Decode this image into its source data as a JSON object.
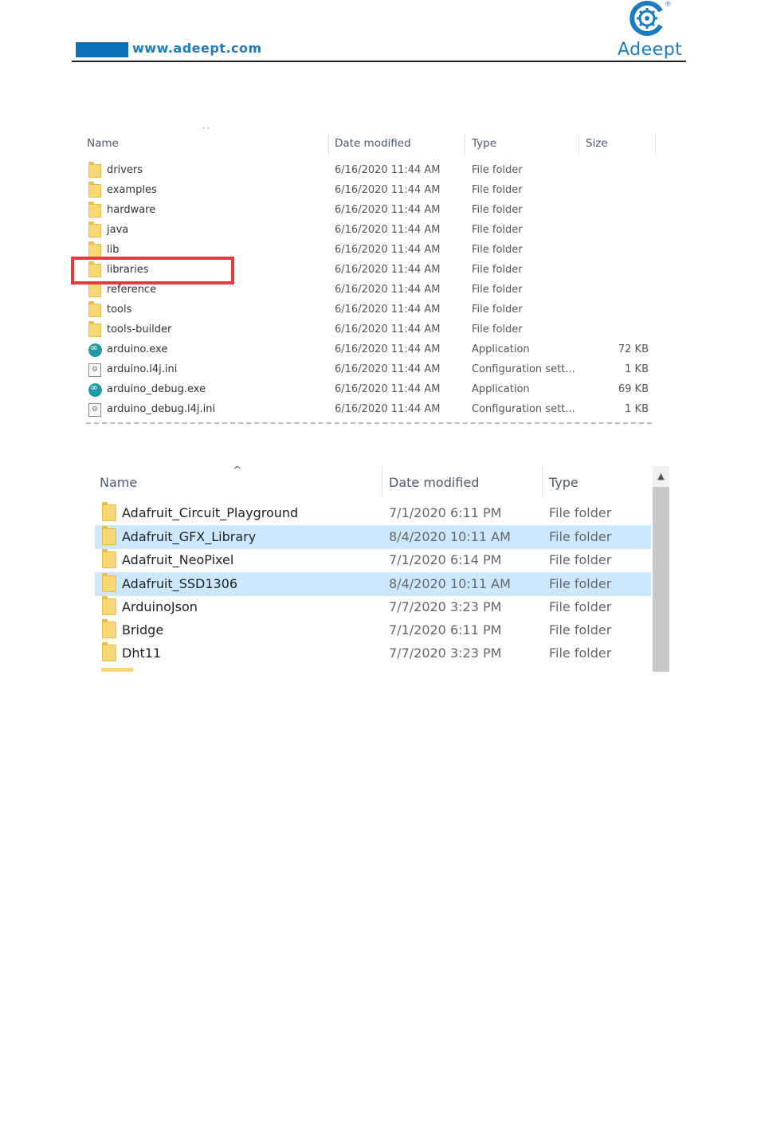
{
  "header": {
    "url": "www.adeept.com",
    "brand": "Adeept",
    "registered": "®"
  },
  "explorer1": {
    "columns": {
      "name": "Name",
      "date": "Date modified",
      "type": "Type",
      "size": "Size"
    },
    "sort_indicator": "˙˙",
    "rows": [
      {
        "icon": "folder-icon",
        "name": "drivers",
        "date": "6/16/2020 11:44 AM",
        "type": "File folder",
        "size": ""
      },
      {
        "icon": "folder-icon",
        "name": "examples",
        "date": "6/16/2020 11:44 AM",
        "type": "File folder",
        "size": ""
      },
      {
        "icon": "folder-icon",
        "name": "hardware",
        "date": "6/16/2020 11:44 AM",
        "type": "File folder",
        "size": ""
      },
      {
        "icon": "folder-icon",
        "name": "java",
        "date": "6/16/2020 11:44 AM",
        "type": "File folder",
        "size": ""
      },
      {
        "icon": "folder-icon",
        "name": "lib",
        "date": "6/16/2020 11:44 AM",
        "type": "File folder",
        "size": ""
      },
      {
        "icon": "folder-icon",
        "name": "libraries",
        "date": "6/16/2020 11:44 AM",
        "type": "File folder",
        "size": "",
        "highlighted": true
      },
      {
        "icon": "folder-icon",
        "name": "reference",
        "date": "6/16/2020 11:44 AM",
        "type": "File folder",
        "size": ""
      },
      {
        "icon": "folder-icon",
        "name": "tools",
        "date": "6/16/2020 11:44 AM",
        "type": "File folder",
        "size": ""
      },
      {
        "icon": "folder-icon",
        "name": "tools-builder",
        "date": "6/16/2020 11:44 AM",
        "type": "File folder",
        "size": ""
      },
      {
        "icon": "arduino-app-icon",
        "name": "arduino.exe",
        "date": "6/16/2020 11:44 AM",
        "type": "Application",
        "size": "72 KB"
      },
      {
        "icon": "config-file-icon",
        "name": "arduino.l4j.ini",
        "date": "6/16/2020 11:44 AM",
        "type": "Configuration sett...",
        "size": "1 KB"
      },
      {
        "icon": "arduino-app-icon",
        "name": "arduino_debug.exe",
        "date": "6/16/2020 11:44 AM",
        "type": "Application",
        "size": "69 KB"
      },
      {
        "icon": "config-file-icon",
        "name": "arduino_debug.l4j.ini",
        "date": "6/16/2020 11:44 AM",
        "type": "Configuration sett...",
        "size": "1 KB"
      }
    ]
  },
  "explorer2": {
    "columns": {
      "name": "Name",
      "date": "Date modified",
      "type": "Type"
    },
    "sort_indicator": "^",
    "scroll_up": "▲",
    "rows": [
      {
        "name": "Adafruit_Circuit_Playground",
        "date": "7/1/2020 6:11 PM",
        "type": "File folder",
        "selected": false
      },
      {
        "name": "Adafruit_GFX_Library",
        "date": "8/4/2020 10:11 AM",
        "type": "File folder",
        "selected": true
      },
      {
        "name": "Adafruit_NeoPixel",
        "date": "7/1/2020 6:14 PM",
        "type": "File folder",
        "selected": false
      },
      {
        "name": "Adafruit_SSD1306",
        "date": "8/4/2020 10:11 AM",
        "type": "File folder",
        "selected": true
      },
      {
        "name": "ArduinoJson",
        "date": "7/7/2020 3:23 PM",
        "type": "File folder",
        "selected": false
      },
      {
        "name": "Bridge",
        "date": "7/1/2020 6:11 PM",
        "type": "File folder",
        "selected": false
      },
      {
        "name": "Dht11",
        "date": "7/7/2020 3:23 PM",
        "type": "File folder",
        "selected": false
      }
    ]
  }
}
